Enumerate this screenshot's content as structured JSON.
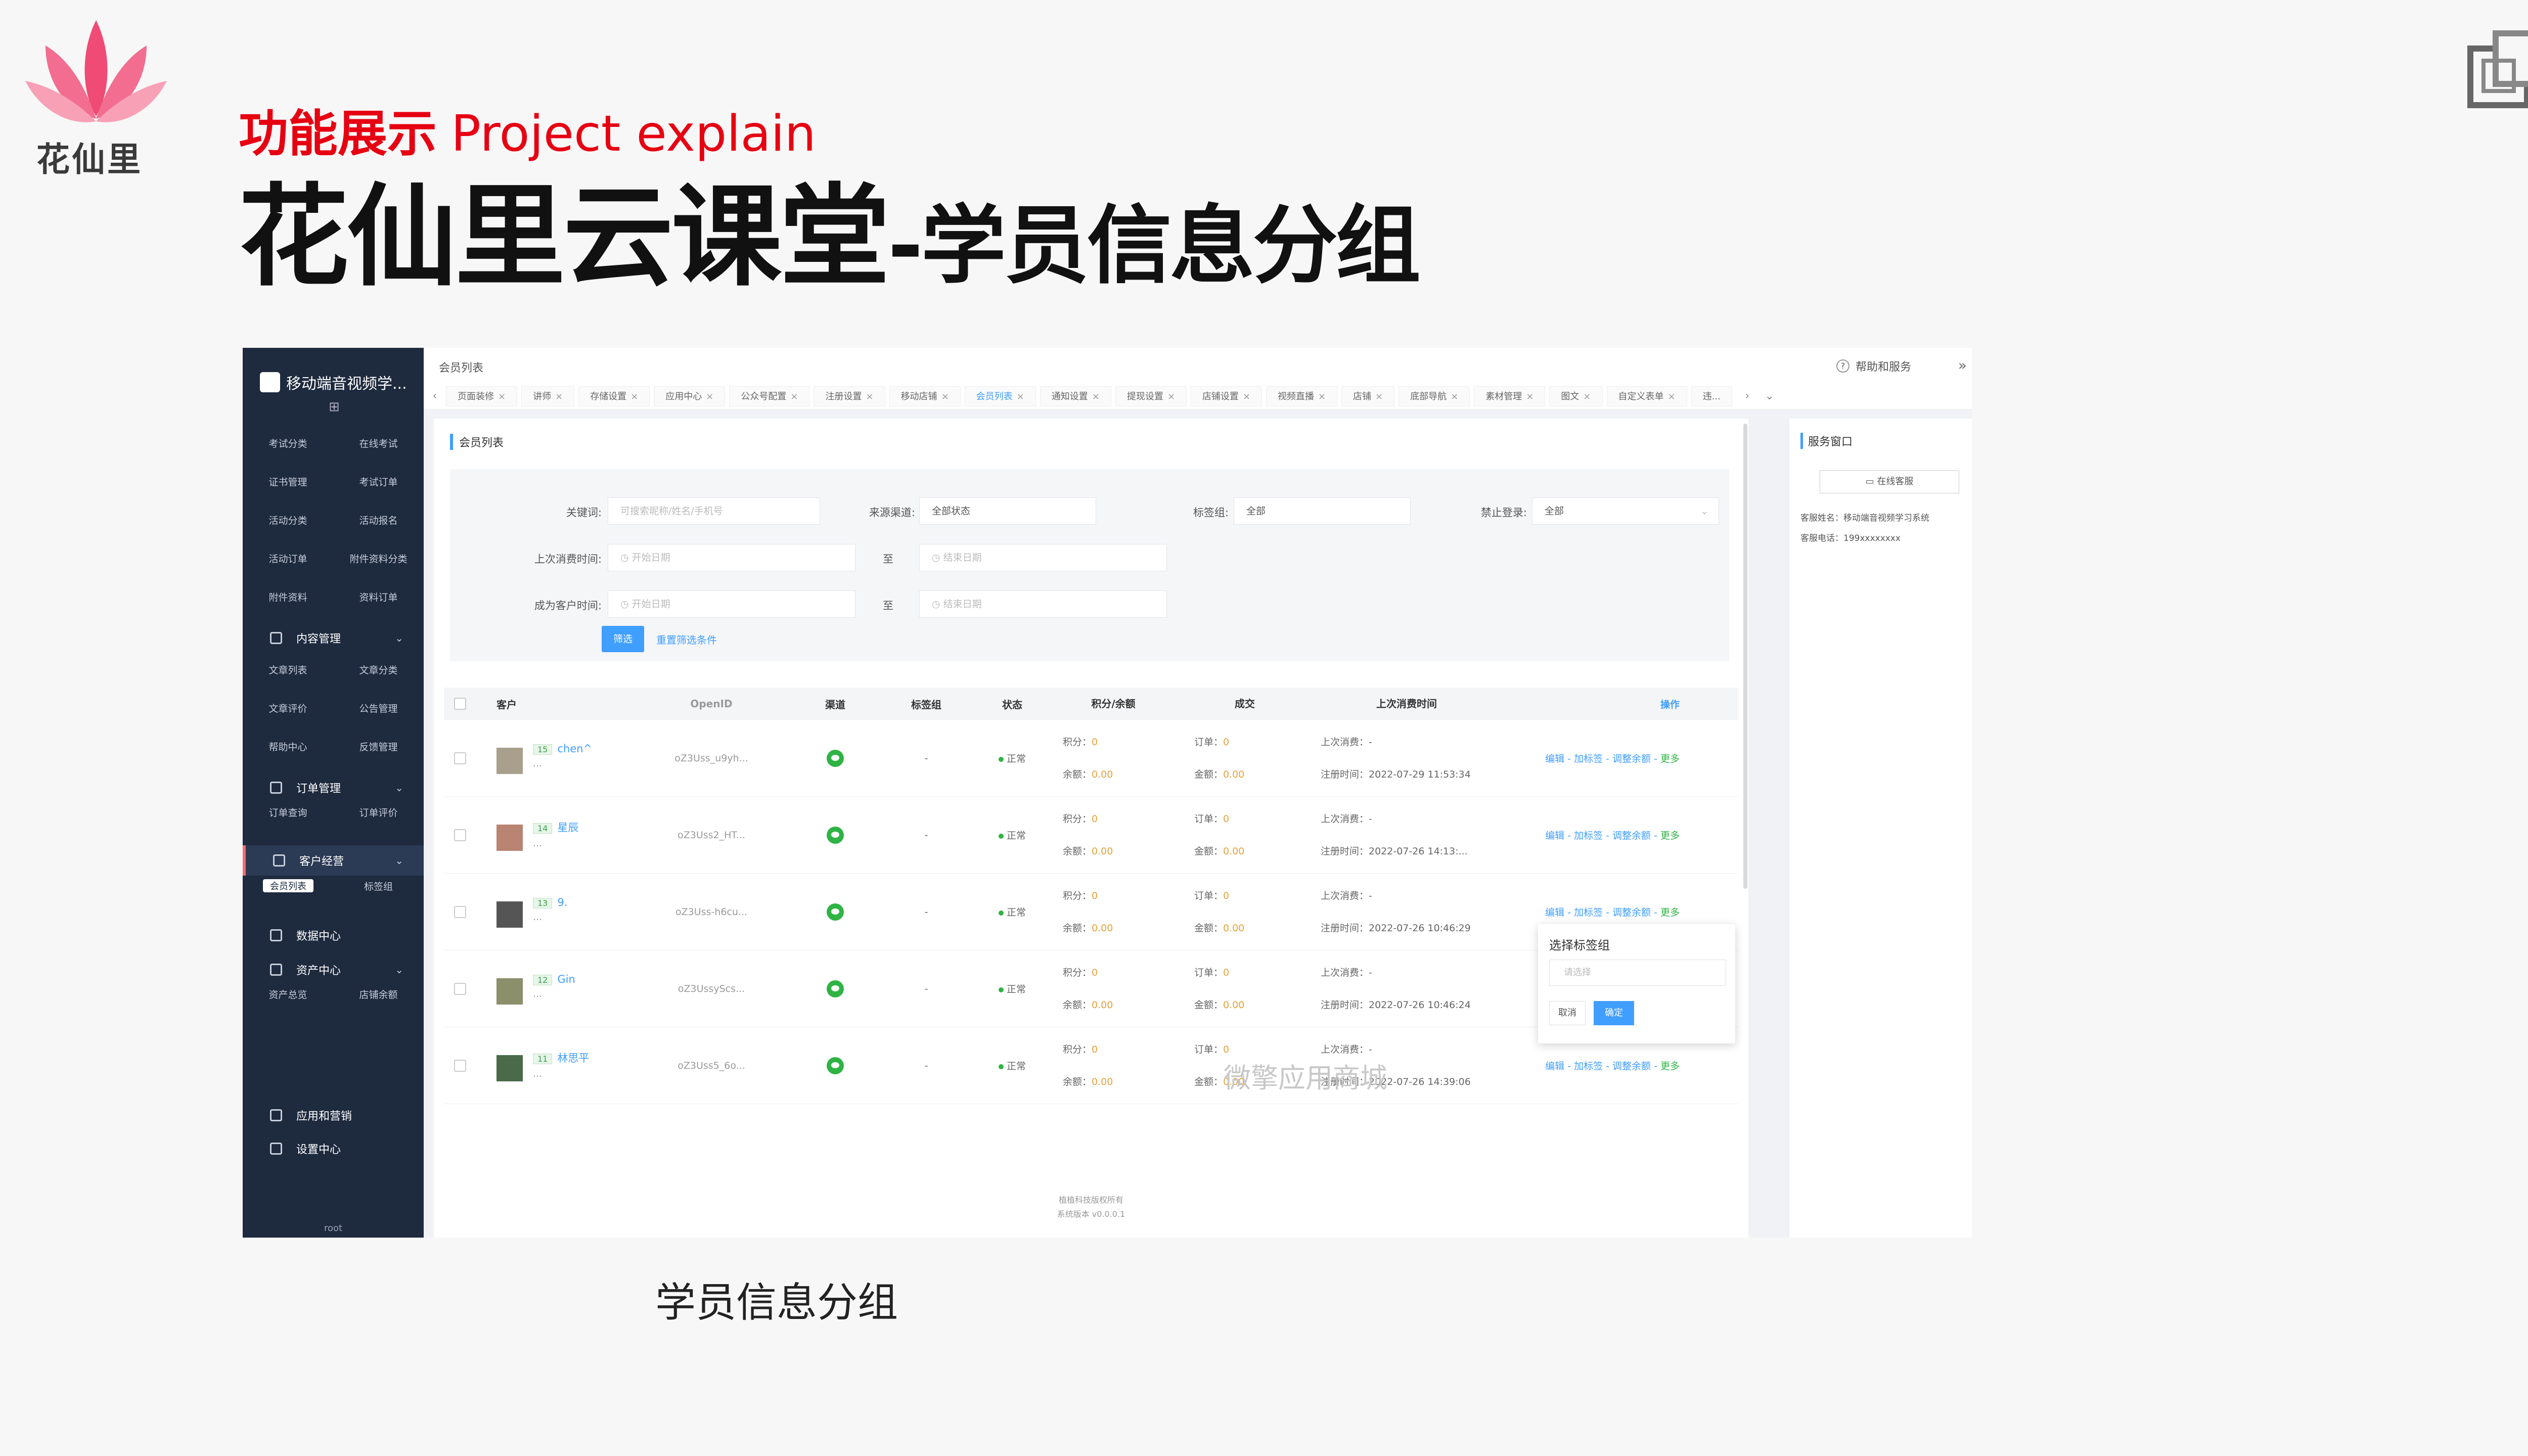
{
  "brand": {
    "logo_text": "花仙里"
  },
  "slide": {
    "section_cn": "功能展示",
    "section_en": "Project explain",
    "title_main": "花仙里云课堂",
    "title_sub": "-学员信息分组",
    "caption": "学员信息分组"
  },
  "app": {
    "name": "移动端音视频学...",
    "breadcrumb": "会员列表",
    "help": "帮助和服务",
    "root_user": "root",
    "watermark": "微擎应用商城",
    "footer_line1": "植植科技版权所有",
    "footer_line2": "系统版本 v0.0.0.1"
  },
  "sidebar": {
    "top_rows": [
      [
        "考试分类",
        "在线考试"
      ],
      [
        "证书管理",
        "考试订单"
      ],
      [
        "活动分类",
        "活动报名"
      ],
      [
        "活动订单",
        "附件资料分类"
      ],
      [
        "附件资料",
        "资料订单"
      ]
    ],
    "content_group": "内容管理",
    "content_rows": [
      [
        "文章列表",
        "文章分类"
      ],
      [
        "文章评价",
        "公告管理"
      ],
      [
        "帮助中心",
        "反馈管理"
      ]
    ],
    "order_group": "订单管理",
    "order_rows": [
      [
        "订单查询",
        "订单评价"
      ]
    ],
    "customer_group": "客户经营",
    "customer_rows": [
      [
        "会员列表",
        "标签组"
      ]
    ],
    "data_group": "数据中心",
    "asset_group": "资产中心",
    "asset_rows": [
      [
        "资产总览",
        "店铺余额"
      ]
    ],
    "apps_group": "应用和营销",
    "settings_group": "设置中心"
  },
  "tabs": [
    "页面装修",
    "讲师",
    "存储设置",
    "应用中心",
    "公众号配置",
    "注册设置",
    "移动店铺",
    "会员列表",
    "通知设置",
    "提现设置",
    "店铺设置",
    "视频直播",
    "店铺",
    "底部导航",
    "素材管理",
    "图文",
    "自定义表单",
    "违..."
  ],
  "active_tab": "会员列表",
  "filters": {
    "keyword_label": "关键词:",
    "keyword_placeholder": "可搜索昵称/姓名/手机号",
    "source_label": "来源渠道:",
    "source_value": "全部状态",
    "tag_label": "标签组:",
    "tag_value": "全部",
    "ban_label": "禁止登录:",
    "ban_value": "全部",
    "last_consume_label": "上次消费时间:",
    "become_label": "成为客户时间:",
    "start_placeholder": "开始日期",
    "end_placeholder": "结束日期",
    "to": "至",
    "filter_btn": "筛选",
    "reset_btn": "重置筛选条件"
  },
  "list_title": "会员列表",
  "table": {
    "headers": [
      "客户",
      "OpenID",
      "渠道",
      "标签组",
      "状态",
      "积分/余额",
      "成交",
      "上次消费时间",
      "操作"
    ],
    "points_label": "积分：",
    "balance_label": "余额：",
    "orders_label": "订单：",
    "amount_label": "金额：",
    "last_consume_label": "上次消费：",
    "register_label": "注册时间：",
    "ops": "编辑 - 加标签 - 调整余额 - ",
    "more": "更多",
    "rows": [
      {
        "level": "15",
        "name": "chen^",
        "openid": "oZ3Uss_u9yh...",
        "tag": "-",
        "status": "正常",
        "points": "0",
        "balance": "0.00",
        "orders": "0",
        "amount": "0.00",
        "last": "-",
        "register": "2022-07-29 11:53:34",
        "avatar": "#a89f8c"
      },
      {
        "level": "14",
        "name": "星辰",
        "openid": "oZ3Uss2_HT...",
        "tag": "-",
        "status": "正常",
        "points": "0",
        "balance": "0.00",
        "orders": "0",
        "amount": "0.00",
        "last": "-",
        "register": "2022-07-26 14:13:...",
        "avatar": "#b98472"
      },
      {
        "level": "13",
        "name": "9.",
        "openid": "oZ3Uss-h6cu...",
        "tag": "-",
        "status": "正常",
        "points": "0",
        "balance": "0.00",
        "orders": "0",
        "amount": "0.00",
        "last": "-",
        "register": "2022-07-26 10:46:29",
        "avatar": "#555555"
      },
      {
        "level": "12",
        "name": "Gin",
        "openid": "oZ3UssyScs...",
        "tag": "-",
        "status": "正常",
        "points": "0",
        "balance": "0.00",
        "orders": "0",
        "amount": "0.00",
        "last": "-",
        "register": "2022-07-26 10:46:24",
        "avatar": "#8b8f6a"
      },
      {
        "level": "11",
        "name": "林思平",
        "openid": "oZ3Uss5_6o...",
        "tag": "-",
        "status": "正常",
        "points": "0",
        "balance": "0.00",
        "orders": "0",
        "amount": "0.00",
        "last": "-",
        "register": "2022-07-26 14:39:06",
        "avatar": "#4a6a4a"
      }
    ]
  },
  "popover": {
    "title": "选择标签组",
    "placeholder": "请选择",
    "cancel": "取消",
    "confirm": "确定"
  },
  "service": {
    "title": "服务窗口",
    "button": "在线客服",
    "name_line": "客服姓名：移动端音视频学习系统",
    "phone_line": "客服电话：199xxxxxxxx"
  },
  "colors": {
    "accent": "#409eff",
    "brand_red": "#e60012",
    "sidebar_bg": "#1e2a3e",
    "success": "#2fb344"
  }
}
